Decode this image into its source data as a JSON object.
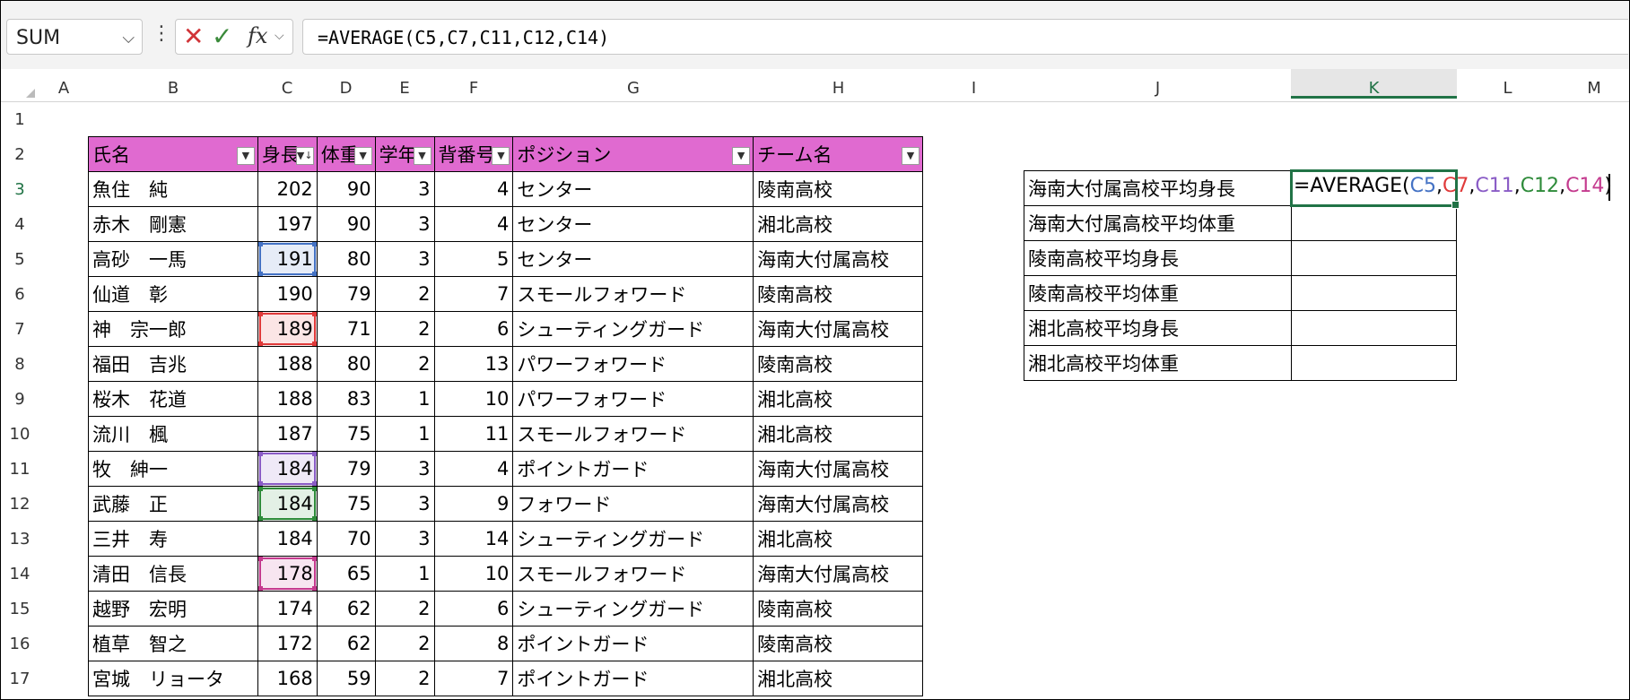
{
  "formula_bar": {
    "name_box": "SUM",
    "formula": "=AVERAGE(C5,C7,C11,C12,C14)"
  },
  "icons": {
    "name_box_chevron": "chevron-down-icon",
    "more": "kebab-icon",
    "cancel": "cancel-icon",
    "enter": "checkmark-icon",
    "function": "fx-icon"
  },
  "columns": [
    "A",
    "B",
    "C",
    "D",
    "E",
    "F",
    "G",
    "H",
    "I",
    "J",
    "K",
    "L",
    "M"
  ],
  "rows": [
    "1",
    "2",
    "3",
    "4",
    "5",
    "6",
    "7",
    "8",
    "9",
    "10",
    "11",
    "12",
    "13",
    "14",
    "15",
    "16",
    "17"
  ],
  "table": {
    "headers": [
      "氏名",
      "身長",
      "体重",
      "学年",
      "背番号",
      "ポジション",
      "チーム名"
    ],
    "header_display": [
      "氏名",
      "身長",
      "体重",
      "学年",
      "背番号",
      "ポジション",
      "チーム名"
    ],
    "rows": [
      [
        "魚住　純",
        "202",
        "90",
        "3",
        "4",
        "センター",
        "陵南高校"
      ],
      [
        "赤木　剛憲",
        "197",
        "90",
        "3",
        "4",
        "センター",
        "湘北高校"
      ],
      [
        "高砂　一馬",
        "191",
        "80",
        "3",
        "5",
        "センター",
        "海南大付属高校"
      ],
      [
        "仙道　彰",
        "190",
        "79",
        "2",
        "7",
        "スモールフォワード",
        "陵南高校"
      ],
      [
        "神　宗一郎",
        "189",
        "71",
        "2",
        "6",
        "シューティングガード",
        "海南大付属高校"
      ],
      [
        "福田　吉兆",
        "188",
        "80",
        "2",
        "13",
        "パワーフォワード",
        "陵南高校"
      ],
      [
        "桜木　花道",
        "188",
        "83",
        "1",
        "10",
        "パワーフォワード",
        "湘北高校"
      ],
      [
        "流川　楓",
        "187",
        "75",
        "1",
        "11",
        "スモールフォワード",
        "湘北高校"
      ],
      [
        "牧　紳一",
        "184",
        "79",
        "3",
        "4",
        "ポイントガード",
        "海南大付属高校"
      ],
      [
        "武藤　正",
        "184",
        "75",
        "3",
        "9",
        "フォワード",
        "海南大付属高校"
      ],
      [
        "三井　寿",
        "184",
        "70",
        "3",
        "14",
        "シューティングガード",
        "湘北高校"
      ],
      [
        "清田　信長",
        "178",
        "65",
        "1",
        "10",
        "スモールフォワード",
        "海南大付属高校"
      ],
      [
        "越野　宏明",
        "174",
        "62",
        "2",
        "6",
        "シューティングガード",
        "陵南高校"
      ],
      [
        "植草　智之",
        "172",
        "62",
        "2",
        "8",
        "ポイントガード",
        "陵南高校"
      ],
      [
        "宮城　リョータ",
        "168",
        "59",
        "2",
        "7",
        "ポイントガード",
        "湘北高校"
      ]
    ]
  },
  "summary": {
    "labels": [
      "海南大付属高校平均身長",
      "海南大付属高校平均体重",
      "陵南高校平均身長",
      "陵南高校平均体重",
      "湘北高校平均身長",
      "湘北高校平均体重"
    ],
    "editing_formula": {
      "prefix": "=AVERAGE(",
      "refs": [
        "C5",
        "C7",
        "C11",
        "C12",
        "C14"
      ],
      "sep": ",",
      "suffix": ")"
    }
  },
  "colors": {
    "header_fill": "#e06ad0",
    "active_border": "#217346",
    "ref_C5": "#4472c4",
    "ref_C7": "#e03a3a",
    "ref_C11": "#8a5cc6",
    "ref_C12": "#2e8b3a",
    "ref_C14": "#c43a8e"
  }
}
